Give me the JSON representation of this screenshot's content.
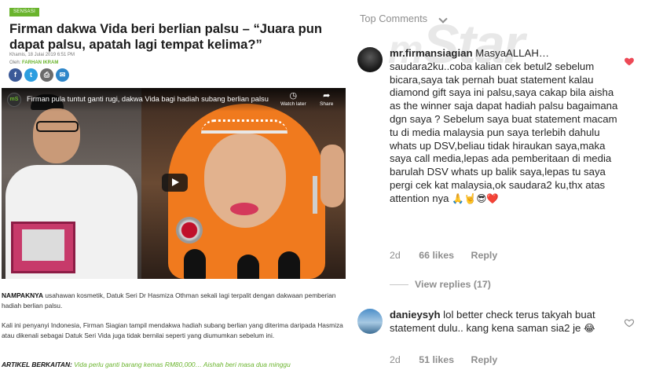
{
  "article": {
    "category": "SENSASI",
    "headline": "Firman dakwa Vida beri berlian palsu – “Juara pun dapat palsu, apatah lagi tempat kelima?”",
    "date": "Khamis, 18 Julai 2019 6:51 PM",
    "byline_label": "Oleh:",
    "author": "FARHAN IKRAM",
    "share_icons": [
      "facebook-icon",
      "twitter-icon",
      "print-icon",
      "email-icon"
    ],
    "video": {
      "channel_initials": "mS",
      "title": "Firman pula tuntut ganti rugi, dakwa Vida bagi hadiah subang berlian palsu",
      "watch_later": "Watch later",
      "share": "Share"
    },
    "para1_lead": "NAMPAKNYA",
    "para1_rest": " usahawan kosmetik, Datuk Seri Dr Hasmiza Othman sekali lagi terpalit dengan dakwaan pemberian hadiah berlian palsu.",
    "para2": "Kali ini penyanyi Indonesia, Firman Siagian tampil mendakwa hadiah subang berlian yang diterima daripada Hasmiza atau dikenali sebagai Datuk Seri Vida juga tidak bernilai seperti yang diumumkan sebelum ini.",
    "related_label": "ARTIKEL BERKAITAN:",
    "related_link": " Vida perlu ganti barang kemas RM80,000… Aishah beri masa dua minggu"
  },
  "comments": {
    "header": "Top Comments",
    "watermark": "Star",
    "watermark_m": "m",
    "items": [
      {
        "username": "mr.firmansiagian",
        "text": " MasyaALLAH…saudara2ku..coba kalian cek betul2 sebelum bicara,saya tak pernah buat statement kalau diamond gift saya ini palsu,saya cakap bila aisha as the winner saja dapat hadiah palsu bagaimana dgn saya ? Sebelum saya buat statement macam tu di media malaysia pun saya terlebih dahulu whats up DSV,beliau tidak hiraukan saya,maka saya call media,lepas ada pemberitaan di media barulah DSV whats up balik saya,lepas tu saya pergi cek kat malaysia,ok saudara2 ku,thx atas attention nya ",
        "emoji": "🙏🤘😎❤️",
        "age": "2d",
        "likes": "66 likes",
        "reply": "Reply",
        "liked": true
      },
      {
        "username": "danieysyh",
        "text": " lol better check terus takyah buat statement dulu.. kang kena saman sia2 je ",
        "emoji": "😂",
        "age": "2d",
        "likes": "51 likes",
        "reply": "Reply",
        "liked": false
      }
    ],
    "view_replies": "View replies (17)"
  },
  "colors": {
    "accent_green": "#6ab42d",
    "heart_red": "#ed4956",
    "meta_gray": "#8e8e8e"
  }
}
